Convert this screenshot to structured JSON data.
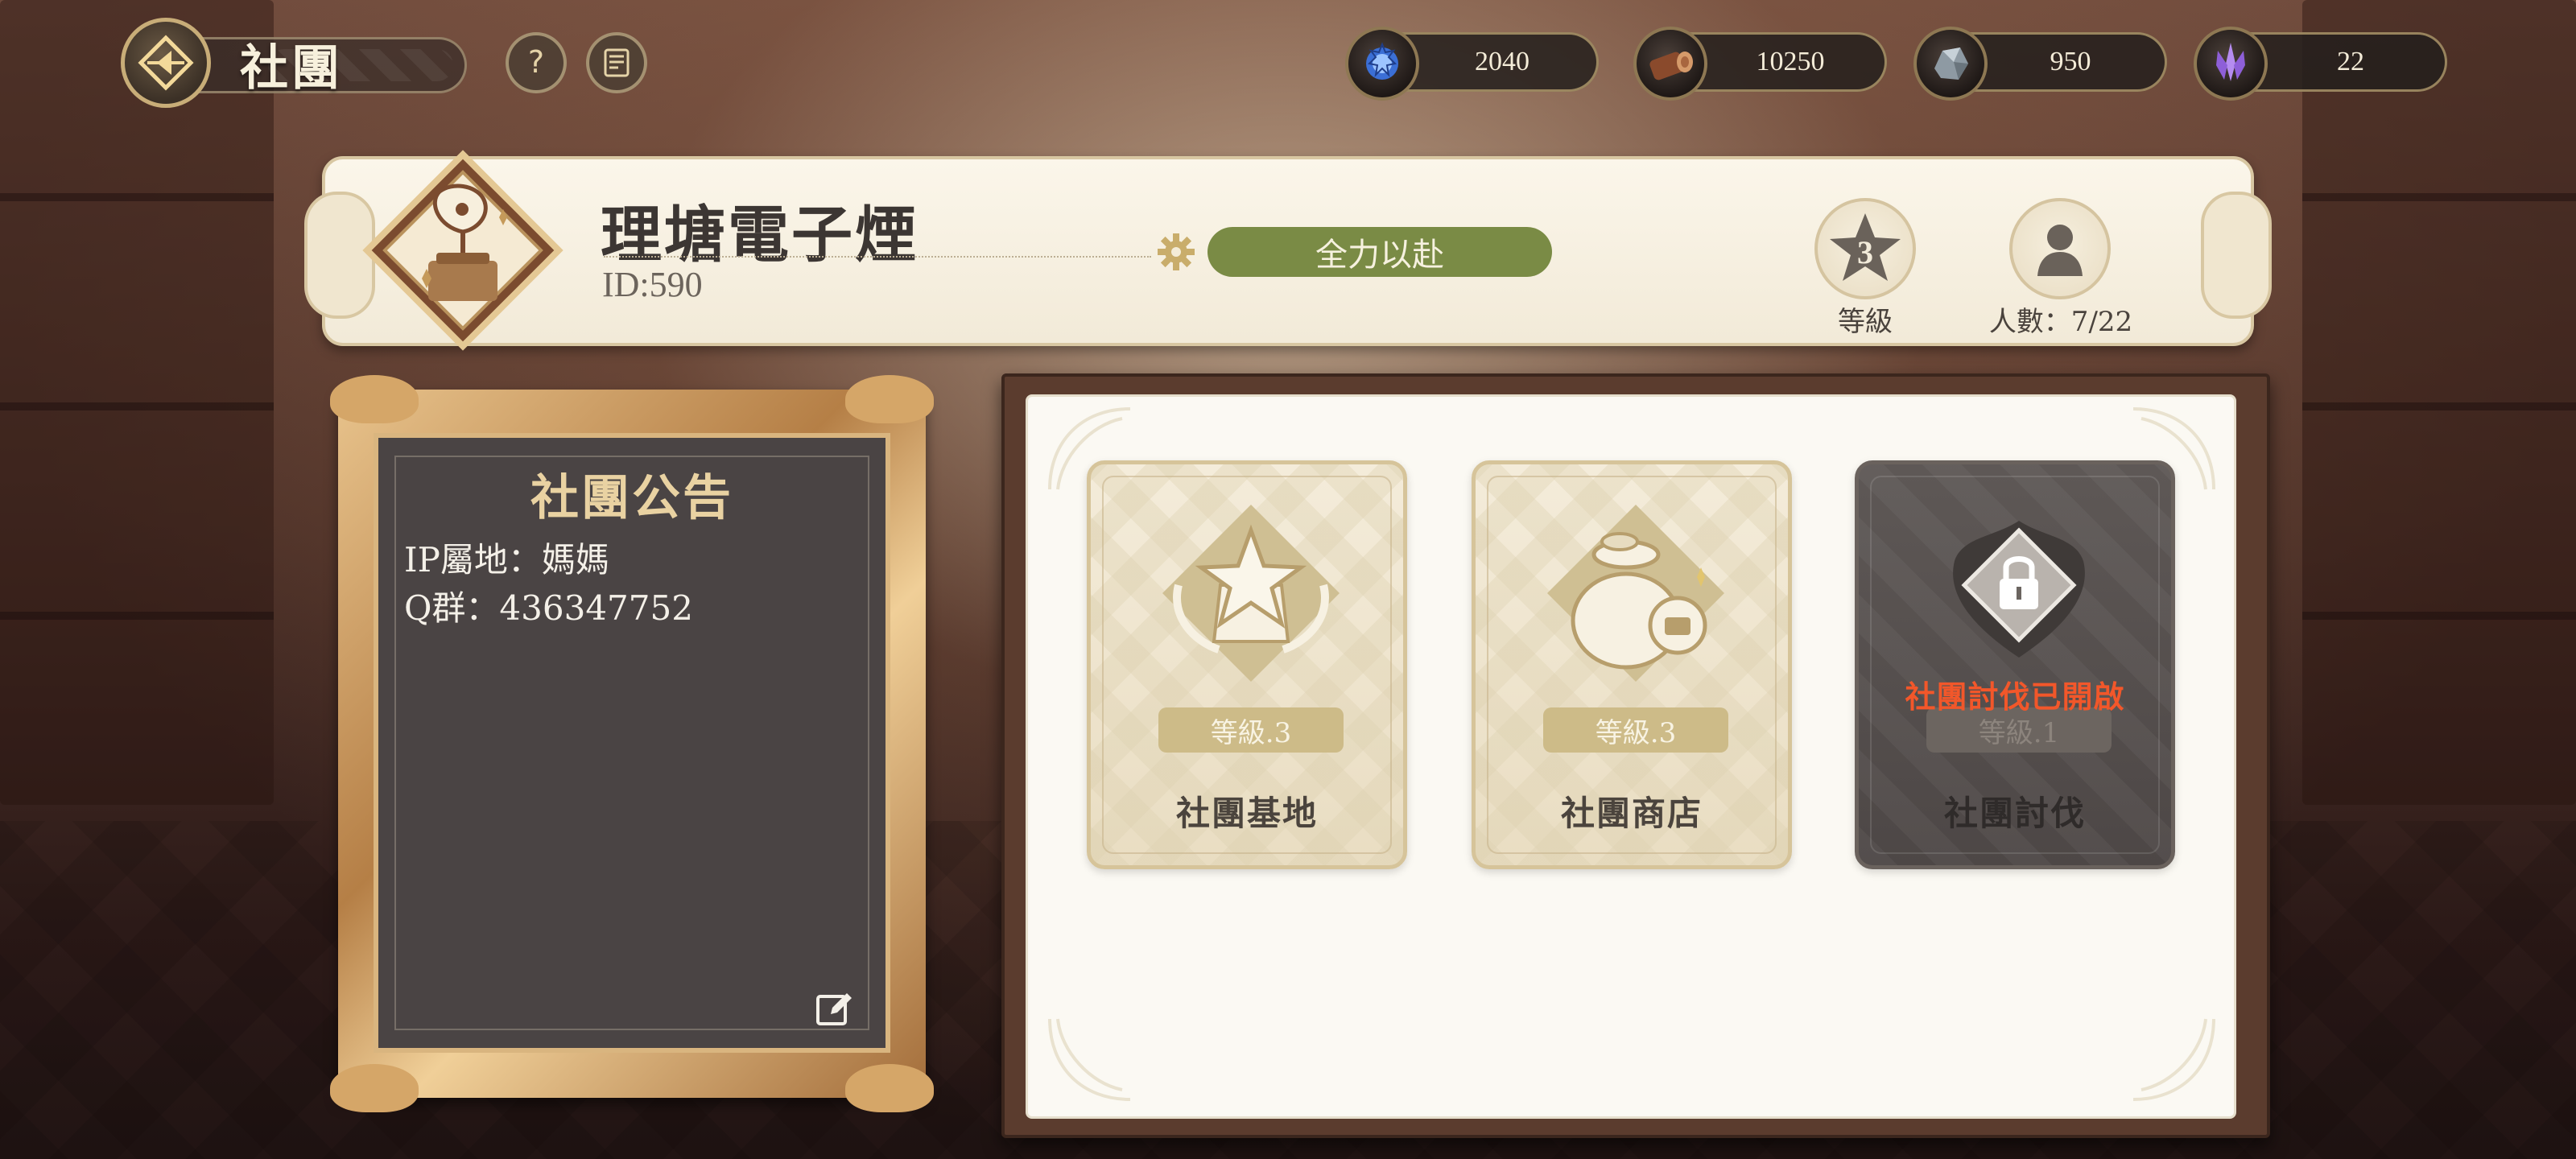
{
  "header": {
    "title": "社團",
    "back_icon": "diamond-arrow-back-icon",
    "help_icon": "question-icon",
    "log_icon": "document-list-icon"
  },
  "resources": [
    {
      "icon": "blue-crest-icon",
      "value": "2040"
    },
    {
      "icon": "wood-log-icon",
      "value": "10250"
    },
    {
      "icon": "iron-ore-icon",
      "value": "950"
    },
    {
      "icon": "purple-crystal-icon",
      "value": "22"
    }
  ],
  "guild": {
    "name": "理塘電子煙",
    "id": "ID:590",
    "mode": "全力以赴",
    "level_value": "3",
    "level_label": "等級",
    "members_label": "人數：7/22"
  },
  "notice": {
    "title": "社團公告",
    "lines": [
      "IP屬地：媽媽",
      "Q群：436347752"
    ]
  },
  "features": [
    {
      "name": "社團基地",
      "level": "等級.3",
      "locked": false,
      "icon": "star-trophy-icon"
    },
    {
      "name": "社團商店",
      "level": "等級.3",
      "locked": false,
      "icon": "coin-bag-icon"
    },
    {
      "name": "社團討伐",
      "level": "等級.1",
      "locked": true,
      "icon": "lock-icon",
      "status": "社團討伐已開啟"
    }
  ],
  "colors": {
    "accent_green": "#7a8b45",
    "locked_red": "#f2572a",
    "gold": "#c8ad78"
  }
}
